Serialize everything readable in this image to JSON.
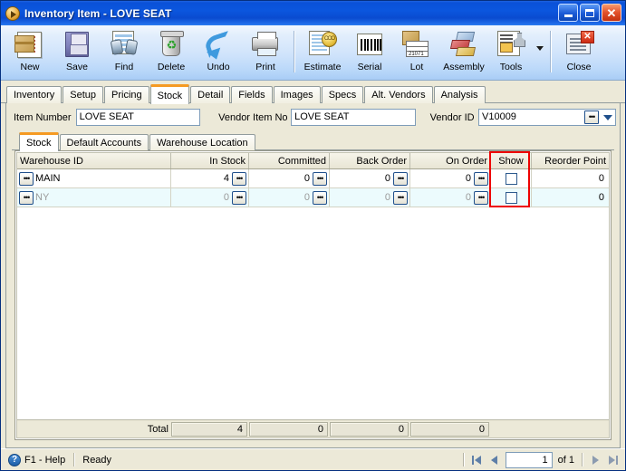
{
  "window": {
    "title_app": "Inventory Item",
    "title_sep": " - ",
    "title_doc": "LOVE SEAT",
    "minimize_label": "Minimize",
    "maximize_label": "Maximize",
    "close_label": "✕"
  },
  "toolbar": {
    "items": [
      {
        "label": "New",
        "icon": "new-document-icon"
      },
      {
        "label": "Save",
        "icon": "floppy-disk-icon"
      },
      {
        "label": "Find",
        "icon": "binoculars-icon"
      },
      {
        "label": "Delete",
        "icon": "recycle-bin-icon"
      },
      {
        "label": "Undo",
        "icon": "undo-arrow-icon"
      },
      {
        "label": "Print",
        "icon": "printer-icon"
      },
      {
        "label": "Estimate",
        "icon": "estimate-seal-icon"
      },
      {
        "label": "Serial",
        "icon": "barcode-icon"
      },
      {
        "label": "Lot",
        "icon": "lot-box-icon"
      },
      {
        "label": "Assembly",
        "icon": "assembly-blocks-icon"
      },
      {
        "label": "Tools",
        "icon": "tools-wrench-icon"
      },
      {
        "label": "Close",
        "icon": "close-window-icon"
      }
    ]
  },
  "tabs": {
    "items": [
      {
        "label": "Inventory",
        "active": false
      },
      {
        "label": "Setup",
        "active": false
      },
      {
        "label": "Pricing",
        "active": false
      },
      {
        "label": "Stock",
        "active": true
      },
      {
        "label": "Detail",
        "active": false
      },
      {
        "label": "Fields",
        "active": false
      },
      {
        "label": "Images",
        "active": false
      },
      {
        "label": "Specs",
        "active": false
      },
      {
        "label": "Alt. Vendors",
        "active": false
      },
      {
        "label": "Analysis",
        "active": false
      }
    ]
  },
  "fields": {
    "item_number_label": "Item Number",
    "item_number_value": "LOVE SEAT",
    "vendor_item_no_label": "Vendor Item No",
    "vendor_item_no_value": "LOVE SEAT",
    "vendor_id_label": "Vendor ID",
    "vendor_id_value": "V10009",
    "lookup_glyph": "•••"
  },
  "inner_tabs": {
    "items": [
      {
        "label": "Stock",
        "active": true
      },
      {
        "label": "Default Accounts",
        "active": false
      },
      {
        "label": "Warehouse Location",
        "active": false
      }
    ]
  },
  "grid": {
    "columns": [
      "Warehouse ID",
      "In Stock",
      "Committed",
      "Back Order",
      "On Order",
      "Show",
      "Reorder Point"
    ],
    "rows": [
      {
        "warehouse_id": "MAIN",
        "in_stock": "4",
        "committed": "0",
        "back_order": "0",
        "on_order": "0",
        "show": false,
        "reorder_point": "0"
      },
      {
        "warehouse_id": "NY",
        "in_stock": "0",
        "committed": "0",
        "back_order": "0",
        "on_order": "0",
        "show": false,
        "reorder_point": "0"
      }
    ],
    "totals": {
      "label": "Total",
      "in_stock": "4",
      "committed": "0",
      "back_order": "0",
      "on_order": "0"
    },
    "ellipsis_glyph": "•••",
    "highlight_color": "#ee0000",
    "highlighted_column": "Show"
  },
  "statusbar": {
    "help_label": "F1 - Help",
    "help_icon_glyph": "?",
    "status_text": "Ready",
    "page_value": "1",
    "of_label": "of  1"
  }
}
